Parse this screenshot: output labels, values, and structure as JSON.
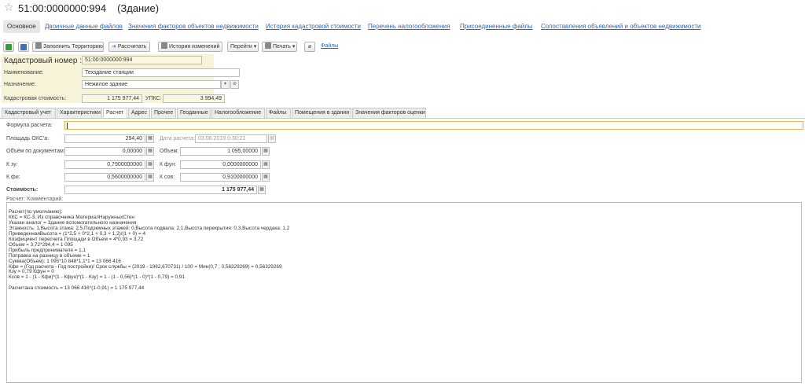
{
  "title": {
    "code": "51:00:0000000:994",
    "kind": "(Здание)"
  },
  "nav": {
    "items": [
      "Основное",
      "Двоичные данные файлов",
      "Значения факторов объектов недвижимости",
      "История кадастровой стоимости",
      "Перечень налогообложения",
      "Присоединенные файлы",
      "Сопоставления объявлений и объектов недвижимости"
    ]
  },
  "toolbar": {
    "fill_territory": "Заполнить Территорию",
    "calculate": "Рассчитать",
    "history": "История изменений",
    "goto": "Перейти",
    "print": "Печать",
    "files": "Файлы"
  },
  "header": {
    "cadastral_label": "Кадастровый номер :",
    "cadastral_value": "51:00:0000000:994",
    "name_label": "Наименование:",
    "name_value": "Техздание станции",
    "purpose_label": "Назначение:",
    "purpose_value": "Нежилое здание",
    "cost_label": "Кадастровая стоимость:",
    "cost_value": "1 175 977,44",
    "upks_label": "УПКС:",
    "upks_value": "3 994,49"
  },
  "subtabs": [
    "Кадастровый учет",
    "Характеристики",
    "Расчет",
    "Адрес",
    "Прочее",
    "Геоданные",
    "Налогообложение",
    "Файлы",
    "Помещения в здании",
    "Значения факторов оценки"
  ],
  "calc": {
    "formula_label": "Формула расчета:",
    "area_label": "Площадь ОКС'а:",
    "area_value": "294,40",
    "date_label": "Дата расчета:",
    "date_value": "03.06.2019  0:30:21",
    "vol_doc_label": "Объём по документам:",
    "vol_doc_value": "0,00000",
    "vol_label": "Объем:",
    "vol_value": "1 095,00000",
    "kzu_label": "К зу:",
    "kzu_value": "0,7900000000",
    "kfun_label": "К фун:",
    "kfun_value": "0,0000000000",
    "kfi_label": "К фи:",
    "kfi_value": "0,5600000000",
    "ksov_label": "К сов:",
    "ksov_value": "0,9100000000",
    "cost_label": "Стоимость:",
    "cost_value": "1 175 977,44",
    "comment_label": "Расчет: Комментарий:"
  },
  "comment": {
    "lines": [
      "Расчет(по умолчанию):",
      "ККС = КС-3. Из справочника МатериалНаружныхСтен",
      "Указан аналог = Здание вспомогательного назначения",
      "Этажность: 1,Высота этажа: 2,5,Подземных этажей: 0,Высота подвала: 2,1,Высота перекрытия: 0,3,Высота чердака: 1,2",
      "ПриведеннаяВысота = (1*2,5 + 0*2,1 + 0,3 + 1,2)/(1 + 0) = 4",
      "Коэфициент пересчета Площади в Объем = 4*0,93 = 3,72",
      "Объем = 3,72*294,4 = 1 095",
      "Прибыль предпринимателя = 1,1",
      "Поправка на разницу в объеме = 1",
      "Сумма(Объем): 1 095*10 848*1,1*1 = 13 066 416",
      "Кфи = (Год расчета - Год постройки)/ Срок службы = (2019 - 1962,670731) / 100 = Мин(0,7 ; 0,56329269) = 0,56329269",
      "Кзу = 0,79 Кфун = 0",
      "Ксов = 1 - (1 - Кфи)*(1 - Кфун)*(1 - Кзу) = 1 - (1 - 0,56)*(1 - 0)*(1 - 0,79) = 0,91",
      "",
      "Расчитана стоимость = 13 066 416*(1-0,91) = 1 175 977,44"
    ]
  },
  "colors": {
    "link": "#2f67b7",
    "header_bg": "#f6f3d9",
    "formula_border": "#e8b94a"
  }
}
